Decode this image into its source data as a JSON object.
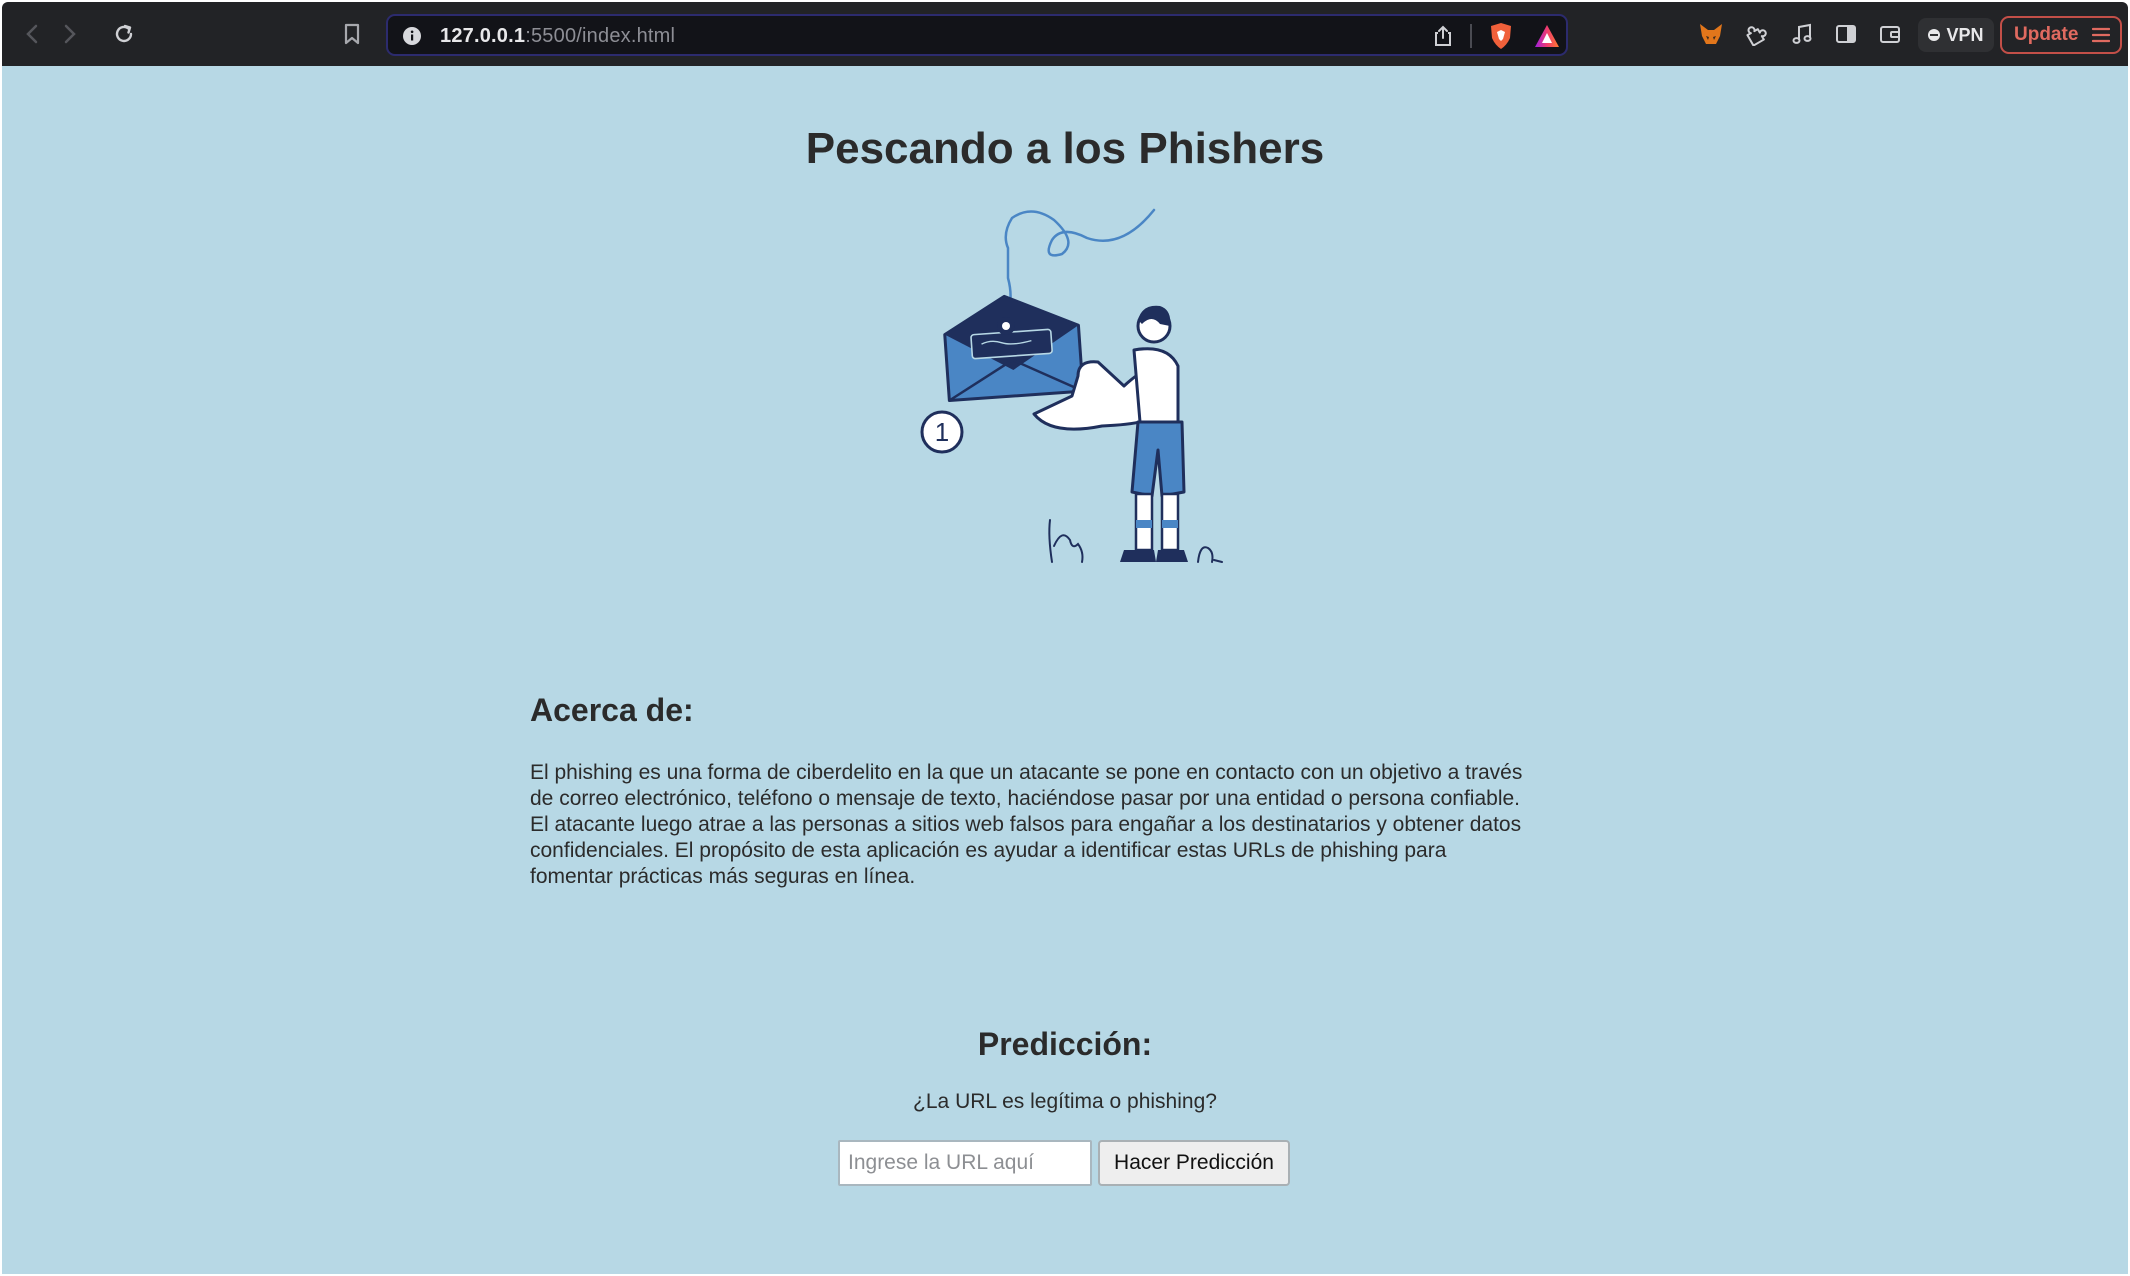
{
  "browser": {
    "url_host": "127.0.0.1",
    "url_path": ":5500/index.html",
    "vpn_label": "VPN",
    "update_label": "Update"
  },
  "page": {
    "title": "Pescando a los Phishers",
    "illustration_badge": "1",
    "about": {
      "heading": "Acerca de:",
      "lines": [
        "El phishing es una forma de ciberdelito en la que un atacante se pone en contacto con un objetivo a través",
        "de correo electrónico, teléfono o mensaje de texto, haciéndose pasar por una entidad o persona confiable.",
        "El atacante luego atrae a las personas a sitios web falsos para engañar a los destinatarios y obtener datos",
        "confidenciales. El propósito de esta aplicación es ayudar a identificar estas URLs de phishing para",
        "fomentar prácticas más seguras en línea."
      ]
    },
    "prediction": {
      "heading": "Predicción:",
      "question": "¿La URL es legítima o phishing?",
      "input_placeholder": "Ingrese la URL aquí",
      "input_value": "",
      "button_label": "Hacer Predicción"
    }
  },
  "colors": {
    "page_background": "#b7d8e5",
    "chrome_background": "#222326",
    "text": "#2b2b2b",
    "illustration_blue": "#4a86c5",
    "illustration_navy": "#1f2f5c",
    "update_accent": "#e06a60"
  },
  "icons": {
    "back": "chevron-left-icon",
    "forward": "chevron-right-icon",
    "reload": "reload-icon",
    "bookmark": "bookmark-icon",
    "site_info": "info-icon",
    "share": "share-icon",
    "brave_shield": "brave-shield-icon",
    "brave_rewards": "rewards-triangle-icon",
    "metamask": "fox-icon",
    "extensions": "puzzle-icon",
    "media": "music-note-icon",
    "sidebar": "sidebar-icon",
    "wallet": "wallet-icon",
    "menu": "hamburger-icon"
  }
}
